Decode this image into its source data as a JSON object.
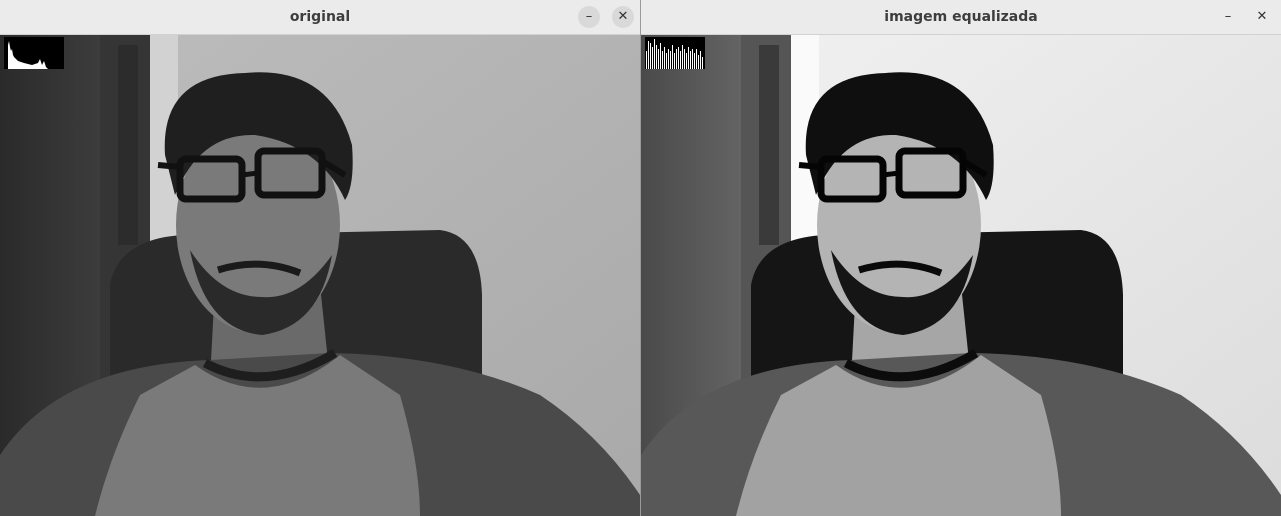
{
  "windows": [
    {
      "title": "original",
      "controls": {
        "minimize_icon": "–",
        "close_icon": "✕"
      },
      "icons": [
        "minimize-icon",
        "close-icon"
      ]
    },
    {
      "title": "imagem equalizada",
      "controls": {
        "minimize_icon": "–",
        "close_icon": "✕"
      },
      "icons": [
        "minimize-icon",
        "close-icon"
      ]
    }
  ],
  "colors": {
    "titlebar": "#ebebeb",
    "title_text": "#3d3d3d"
  }
}
